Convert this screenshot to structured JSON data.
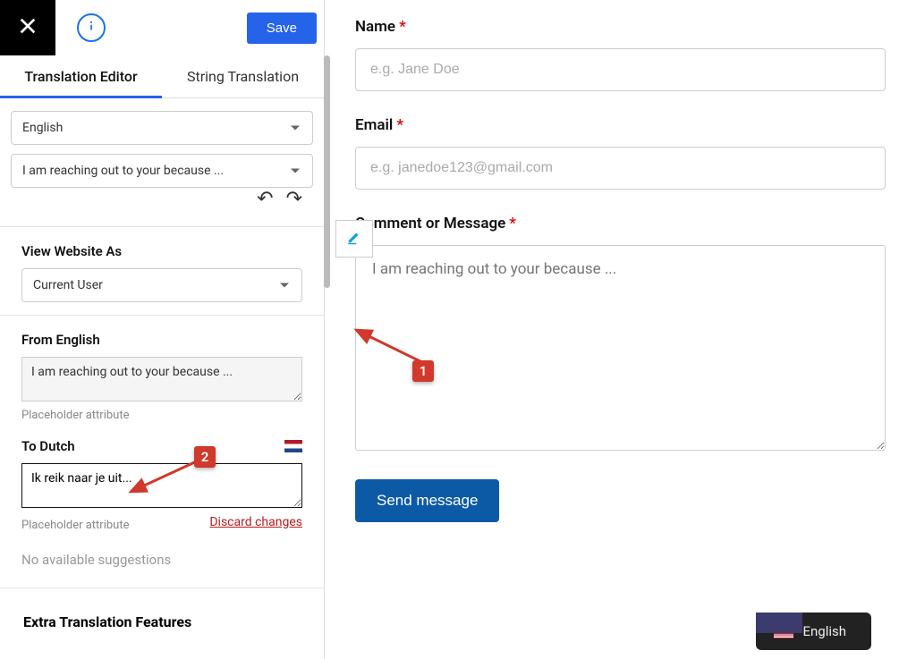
{
  "topbar": {
    "save_label": "Save"
  },
  "tabs": {
    "editor": "Translation Editor",
    "string": "String Translation"
  },
  "source_lang_select": "English",
  "string_select": "I am reaching out to your because ...",
  "view_as": {
    "heading": "View Website As",
    "value": "Current User"
  },
  "from": {
    "heading": "From English",
    "value": "I am reaching out to your because ...",
    "hint": "Placeholder attribute"
  },
  "to": {
    "heading": "To Dutch",
    "value": "Ik reik naar je uit...",
    "hint": "Placeholder attribute",
    "discard": "Discard changes"
  },
  "no_suggestions": "No available suggestions",
  "extra_heading": "Extra Translation Features",
  "main": {
    "name_label": "Name",
    "name_placeholder": "e.g. Jane Doe",
    "email_label": "Email",
    "email_placeholder": "e.g. janedoe123@gmail.com",
    "comment_label": "Comment or Message",
    "comment_placeholder": "I am reaching out to your because ...",
    "send_label": "Send message"
  },
  "lang_switch": "English",
  "annotations": {
    "badge1": "1",
    "badge2": "2"
  }
}
